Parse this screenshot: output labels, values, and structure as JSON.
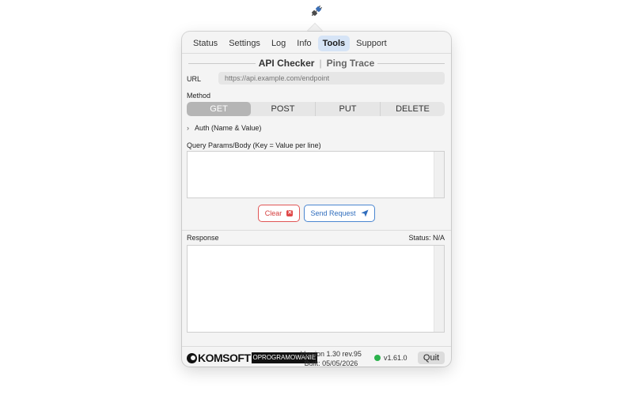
{
  "tray": {
    "icon": "network-plug-icon"
  },
  "tabs": [
    {
      "label": "Status"
    },
    {
      "label": "Settings"
    },
    {
      "label": "Log"
    },
    {
      "label": "Info"
    },
    {
      "label": "Tools",
      "active": true
    },
    {
      "label": "Support"
    }
  ],
  "subtabs": {
    "api_checker": "API Checker",
    "separator": "|",
    "ping_trace": "Ping Trace"
  },
  "url": {
    "label": "URL",
    "placeholder": "https://api.example.com/endpoint",
    "value": ""
  },
  "method": {
    "label": "Method",
    "options": [
      "GET",
      "POST",
      "PUT",
      "DELETE"
    ],
    "selected": "GET"
  },
  "auth": {
    "label": "Auth (Name & Value)",
    "icon": "chevron-right-icon"
  },
  "params": {
    "label": "Query Params/Body (Key = Value per line)",
    "value": ""
  },
  "buttons": {
    "clear": "Clear",
    "send": "Send Request"
  },
  "response": {
    "label": "Response",
    "status": "Status: N/A",
    "value": ""
  },
  "footer": {
    "logo_text": "KOMSOFT",
    "logo_sub": "OPROGRAMOWANIE",
    "version_line": "Version 1.30 rev.95",
    "built_line": "Built: 05/05/2026",
    "runtime_version": "v1.61.0",
    "quit": "Quit"
  },
  "colors": {
    "accent": "#2f6dbd",
    "danger": "#d43c3c",
    "status_ok": "#2bb24c",
    "tab_active_bg": "#d6e4f6"
  }
}
